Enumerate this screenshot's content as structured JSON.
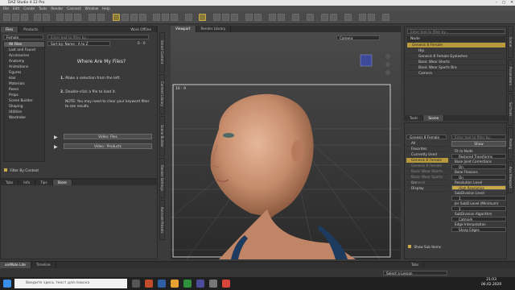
{
  "window": {
    "title": "DAZ Studio 4.12 Pro",
    "controls": [
      "–",
      "□",
      "✕"
    ]
  },
  "menu": [
    "File",
    "Edit",
    "Create",
    "Tools",
    "Render",
    "Connect",
    "Window",
    "Help"
  ],
  "left_panel": {
    "tabs": [
      "Files",
      "Products"
    ],
    "work_offline": "Work Offline",
    "category_dropdown": "Female",
    "search_placeholder": "Enter text to filter by...",
    "sort_label": "Sort by: Name : A to Z",
    "page_count": "0 - 0",
    "categories": [
      "All Files",
      "Lost and Found",
      "Accessories",
      "Anatomy",
      "Animations",
      "Figures",
      "Hair",
      "Materials",
      "Poses",
      "Props",
      "Scene Builder",
      "Shaping",
      "Utilities",
      "Wardrobe"
    ],
    "help_title": "Where Are My Files?",
    "steps": [
      {
        "n": "1.",
        "text": "Make a selection from the left."
      },
      {
        "n": "2.",
        "text": "Double-click a file to load it."
      }
    ],
    "note": "NOTE: You may need to clear your keyword filter to see results.",
    "video_files": "Video: Files",
    "video_products": "Video : Products",
    "filter_label": "Filter By Context",
    "bottom_tabs": [
      "Tabs",
      "Info",
      "Tips",
      "Store"
    ]
  },
  "vertical_tabs_left": [
    "Smart Content",
    "Content Library",
    "Scene Builder",
    "Render Settings",
    "Animate Presets"
  ],
  "viewport": {
    "tabs": [
      "Viewport",
      "Render Library"
    ],
    "camera": "Camera",
    "aspect_label": "16 : 9"
  },
  "scene": {
    "search_placeholder": "Enter text to filter by...",
    "header": "Node",
    "items": [
      "Genesis 8 Female",
      "Hip",
      "Genesis 8 Female Eyelashes",
      "Basic Wear Shorts",
      "Basic Wear Sports Bra",
      "Camera"
    ],
    "tabs": [
      "Tools",
      "Scene"
    ]
  },
  "parameters": {
    "figure_dropdown": "Genesis 8 Female",
    "groups": [
      "All",
      "Favorites",
      "Currently Used",
      "Genesis 8 Female",
      "Genesis 8 Female",
      "Basic Wear Shorts",
      "Basic Wear Sports Bra",
      "General",
      "Display"
    ],
    "search_placeholder": "Enter text to filter by...",
    "show_label": "Show",
    "props": [
      {
        "label": "Fit to Node",
        "value": "Restored Transforms"
      },
      {
        "label": "Base Joint Corrections",
        "value": "On"
      },
      {
        "label": "Base Flexions",
        "value": "On"
      },
      {
        "label": "Resolution Level",
        "value": "High Resolution"
      },
      {
        "label": "SubDivision Level",
        "value": "1"
      },
      {
        "label": "Jer SubD Level (Minimum)",
        "value": "1"
      },
      {
        "label": "SubDivision Algorithm",
        "value": "Catmark"
      },
      {
        "label": "Edge Interpolation",
        "value": "Sharp Edges"
      }
    ],
    "show_sub_items": "Show Sub Items"
  },
  "right_vertical_tabs": [
    "Scene",
    "Parameters",
    "Surfaces",
    "Posing",
    "Aux Viewport"
  ],
  "bottom": {
    "tabs": [
      "aniMate Lite",
      "Timeline"
    ],
    "lesson": "Select a Lesson",
    "panel_tab": "Tabs"
  },
  "taskbar": {
    "search_text": "Введите здесь текст для поиска",
    "time": "21:03",
    "date": "06.02.2020"
  }
}
